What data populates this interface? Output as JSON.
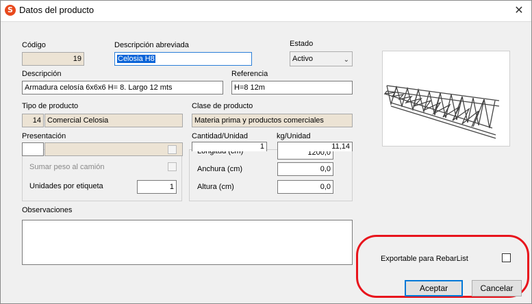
{
  "window": {
    "title": "Datos del producto",
    "app_icon_letter": "S",
    "close_label": "✕"
  },
  "form": {
    "codigo_label": "Código",
    "codigo_value": "19",
    "desc_abrev_label": "Descripción abreviada",
    "desc_abrev_value": "Celosia H8",
    "estado_label": "Estado",
    "estado_value": "Activo",
    "descripcion_label": "Descripción",
    "descripcion_value": "Armadura celosía 6x6x6  H= 8. Largo 12 mts",
    "referencia_label": "Referencia",
    "referencia_value": "H=8 12m",
    "tipo_label": "Tipo de producto",
    "tipo_code": "14",
    "tipo_value": "Comercial Celosia",
    "clase_label": "Clase de producto",
    "clase_value": "Materia prima y productos comerciales",
    "presentacion_label": "Presentación",
    "cantidad_label": "Cantidad/Unidad",
    "cantidad_value": "1",
    "kg_label": "kg/Unidad",
    "kg_value": "11,14",
    "longitud_label": "Longitud (cm)",
    "longitud_value": "1200,0",
    "sumar_peso_label": "Sumar peso al camión",
    "unidades_label": "Unidades por etiqueta",
    "unidades_value": "1",
    "anchura_label": "Anchura (cm)",
    "anchura_value": "0,0",
    "altura_label": "Altura (cm)",
    "altura_value": "0,0",
    "observaciones_label": "Observaciones",
    "exportable_label": "Exportable para RebarList",
    "exportable_checked": false
  },
  "buttons": {
    "aceptar": "Aceptar",
    "cancelar": "Cancelar"
  },
  "colors": {
    "readonly_bg": "#ece3d4",
    "highlight_ring": "#e8141c",
    "selection": "#0a64d8"
  }
}
